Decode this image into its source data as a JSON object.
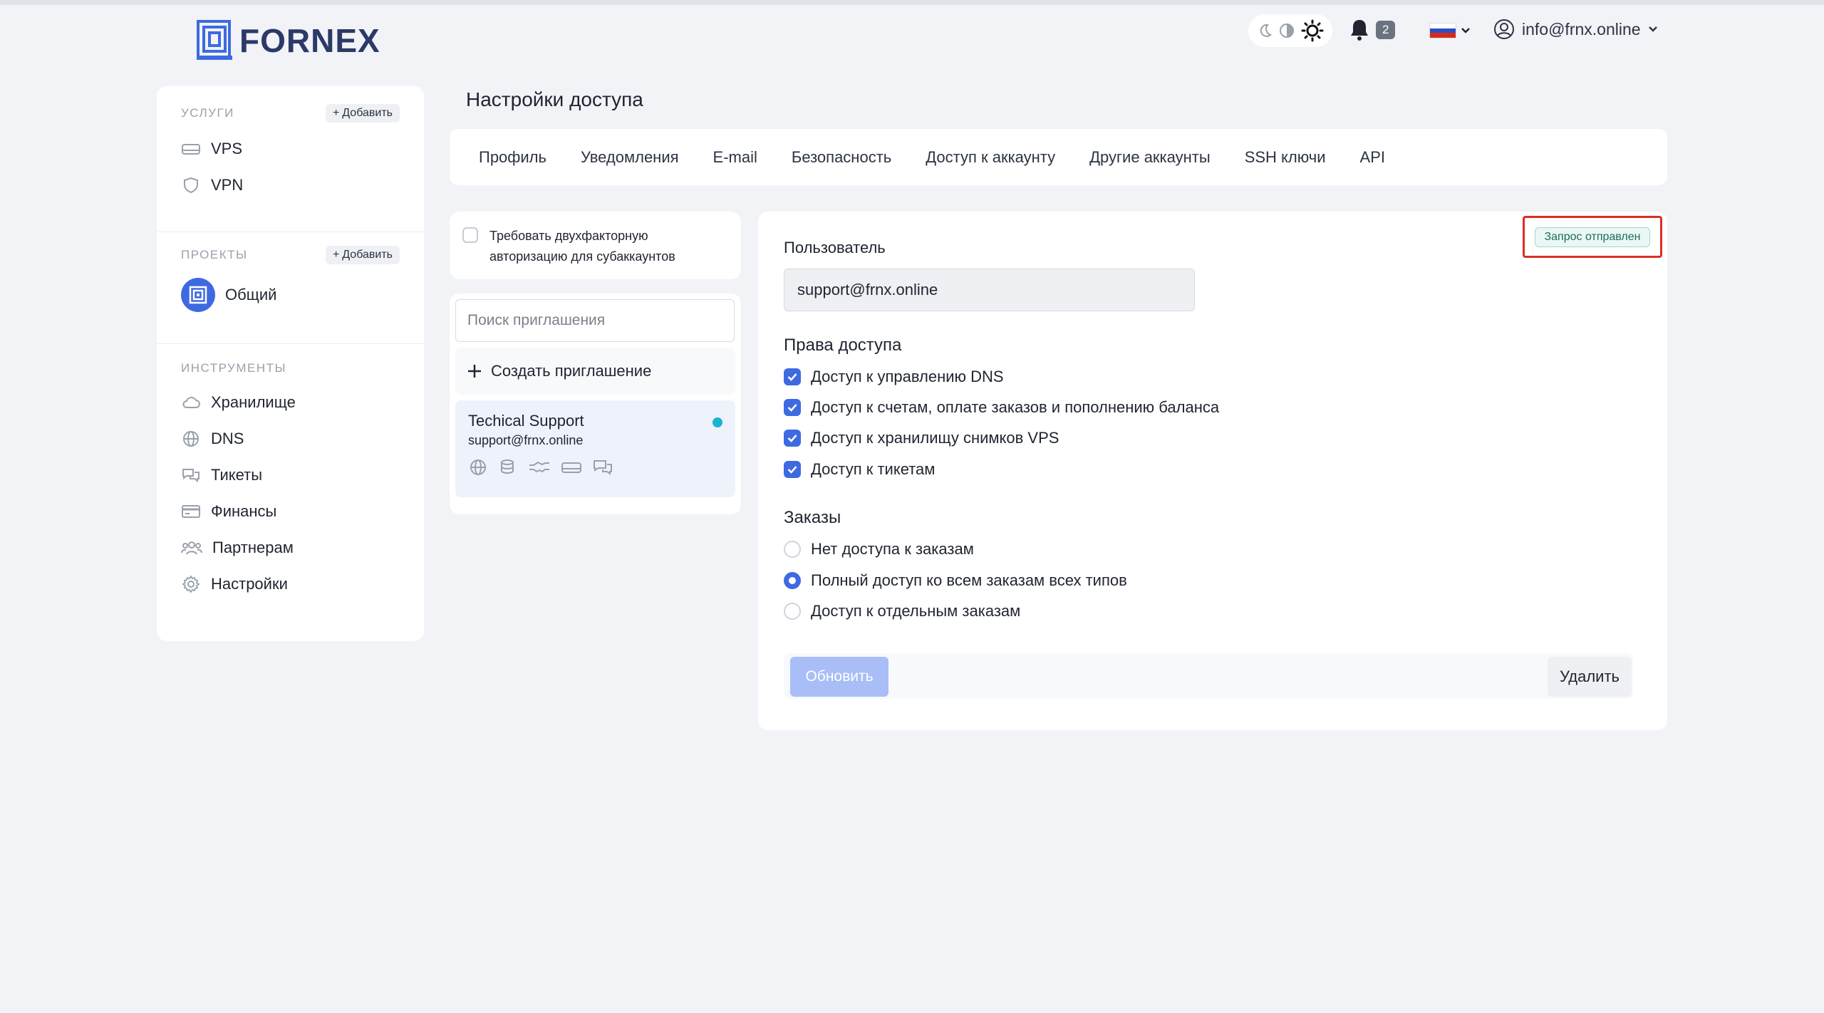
{
  "header": {
    "logo_text": "FORNEX",
    "notifications_count": "2",
    "user_email": "info@frnx.online",
    "language_flag": "ru-flag"
  },
  "sidebar": {
    "services_title": "УСЛУГИ",
    "services_add": "Добавить",
    "services": [
      {
        "label": "VPS",
        "icon": "server-icon"
      },
      {
        "label": "VPN",
        "icon": "shield-icon"
      }
    ],
    "projects_title": "ПРОЕКТЫ",
    "projects_add": "Добавить",
    "projects": [
      {
        "label": "Общий",
        "icon": "project-logo-icon"
      }
    ],
    "tools_title": "ИНСТРУМЕНТЫ",
    "tools": [
      {
        "label": "Хранилище",
        "icon": "cloud-icon"
      },
      {
        "label": "DNS",
        "icon": "globe-icon"
      },
      {
        "label": "Тикеты",
        "icon": "chat-icon"
      },
      {
        "label": "Финансы",
        "icon": "card-icon"
      },
      {
        "label": "Партнерам",
        "icon": "users-icon"
      },
      {
        "label": "Настройки",
        "icon": "gear-icon"
      }
    ]
  },
  "page": {
    "title": "Настройки доступа",
    "tabs": [
      {
        "label": "Профиль"
      },
      {
        "label": "Уведомления"
      },
      {
        "label": "E-mail"
      },
      {
        "label": "Безопасность"
      },
      {
        "label": "Доступ к аккаунту"
      },
      {
        "label": "Другие аккаунты"
      },
      {
        "label": "SSH ключи"
      },
      {
        "label": "API"
      }
    ]
  },
  "invites": {
    "twofa_line1": "Требовать двухфакторную",
    "twofa_line2": "авторизацию для субаккаунтов",
    "search_placeholder": "Поиск приглашения",
    "create_label": "Создать приглашение",
    "items": [
      {
        "name": "Techical Support",
        "email": "support@frnx.online"
      }
    ]
  },
  "form": {
    "status_badge": "Запрос отправлен",
    "user_label": "Пользователь",
    "user_value": "support@frnx.online",
    "rights_title": "Права доступа",
    "rights": [
      {
        "label": "Доступ к управлению DNS",
        "checked": true
      },
      {
        "label": "Доступ к счетам, оплате заказов и пополнению баланса",
        "checked": true
      },
      {
        "label": "Доступ к хранилищу снимков VPS",
        "checked": true
      },
      {
        "label": "Доступ к тикетам",
        "checked": true
      }
    ],
    "orders_title": "Заказы",
    "orders": [
      {
        "label": "Нет доступа к заказам",
        "selected": false
      },
      {
        "label": "Полный доступ ко всем заказам всех типов",
        "selected": true
      },
      {
        "label": "Доступ к отдельным заказам",
        "selected": false
      }
    ],
    "update_button": "Обновить",
    "delete_button": "Удалить"
  },
  "colors": {
    "accent": "#3e6ae1",
    "status_border": "#d93025",
    "background": "#f1f3f7"
  }
}
